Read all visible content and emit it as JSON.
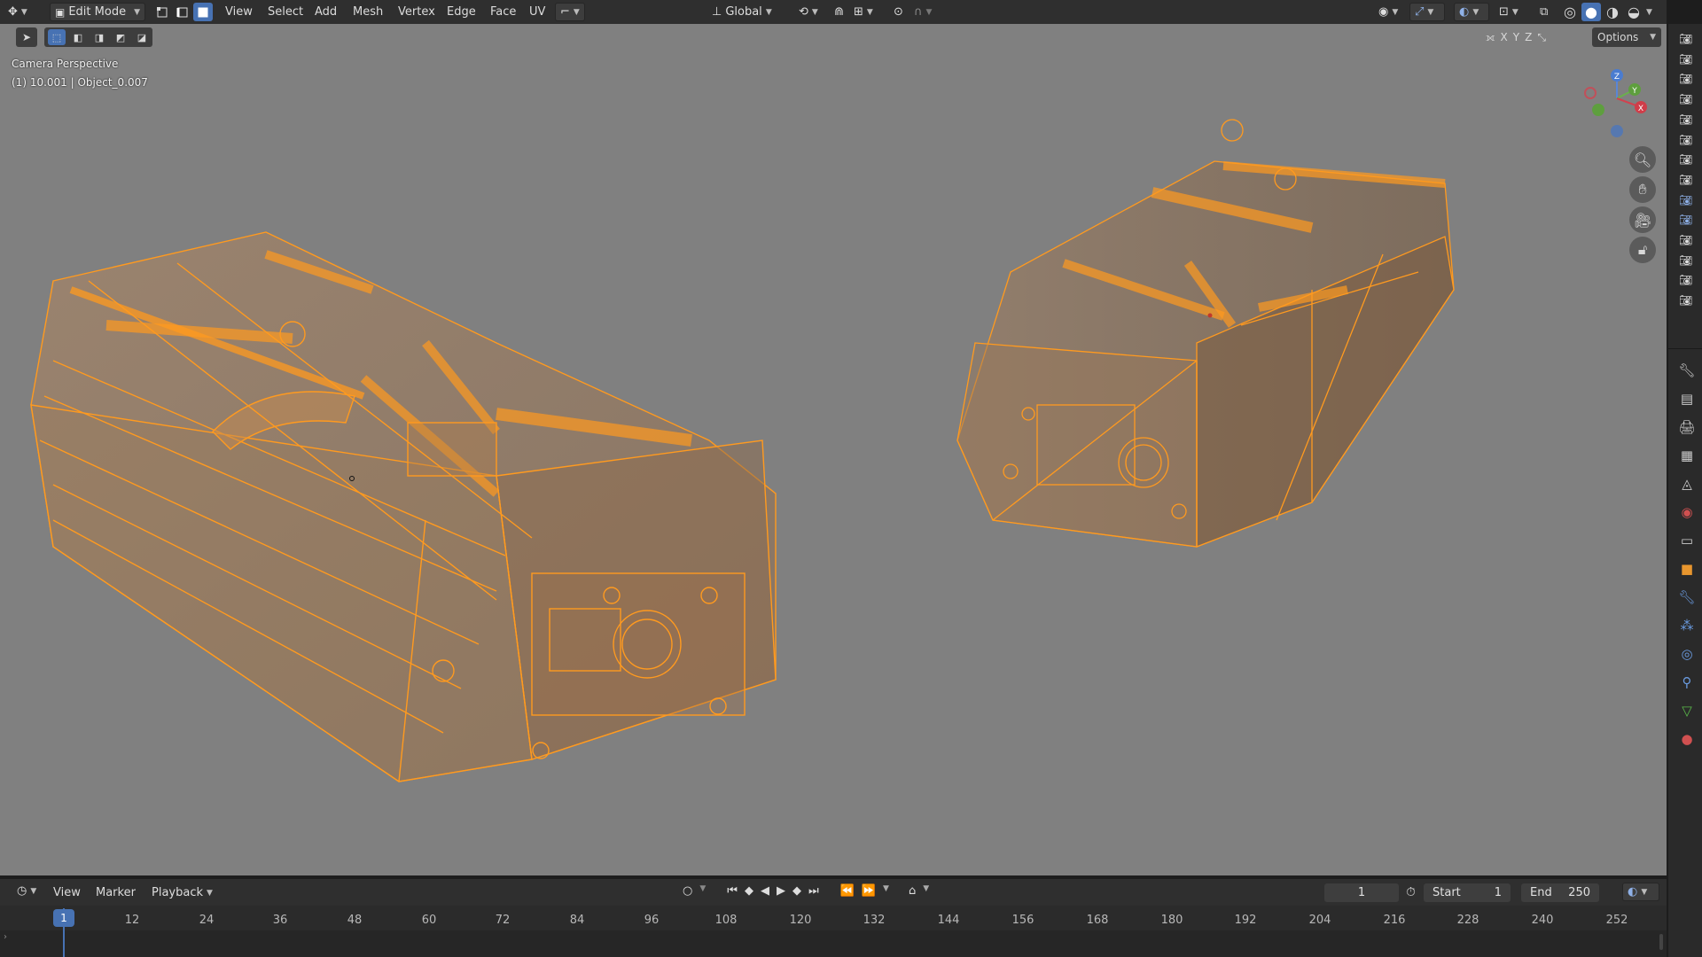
{
  "header": {
    "mode_label": "Edit Mode",
    "menus": [
      "View",
      "Select",
      "Add",
      "Mesh",
      "Vertex",
      "Edge",
      "Face",
      "UV"
    ],
    "orientation_label": "Global",
    "options_label": "Options",
    "axis_x": "X",
    "axis_y": "Y",
    "axis_z": "Z"
  },
  "viewport": {
    "perspective_label": "Camera Perspective",
    "object_info": "(1) 10.001 | Object_0.007",
    "gizmo": {
      "x": "X",
      "y": "Y",
      "z": "Z"
    },
    "wire_color": "#ff9a1f",
    "background_color": "#808080"
  },
  "timeline": {
    "menus": [
      "View",
      "Marker",
      "Playback"
    ],
    "current_frame": "1",
    "start_label": "Start",
    "start_value": "1",
    "end_label": "End",
    "end_value": "250",
    "playhead_label": "1",
    "ticks": [
      "12",
      "24",
      "36",
      "48",
      "60",
      "72",
      "84",
      "96",
      "108",
      "120",
      "132",
      "144",
      "156",
      "168",
      "180",
      "192",
      "204",
      "216",
      "228",
      "240",
      "252"
    ]
  },
  "colors": {
    "accent": "#4772b3",
    "header_bg": "#2f2f2f",
    "selection_orange": "#ff9a1f"
  }
}
